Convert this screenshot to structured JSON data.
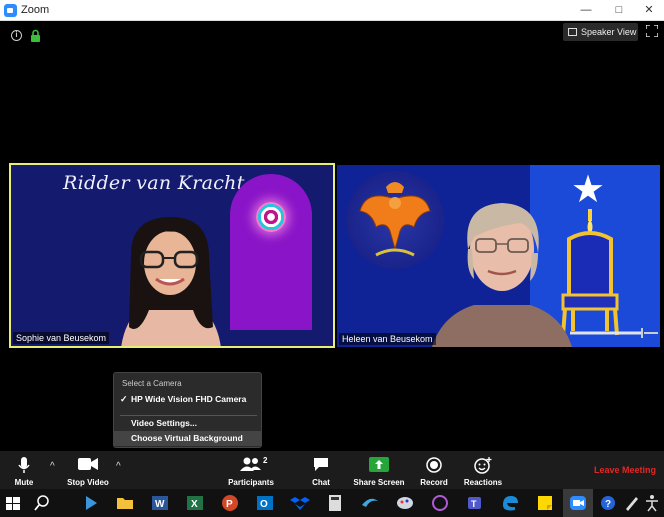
{
  "window": {
    "title": "Zoom",
    "minimize": "—",
    "maximize": "□",
    "close": "✕"
  },
  "topbar": {
    "info": "i",
    "view_label": "Speaker View"
  },
  "tiles": {
    "left": {
      "name": "Sophie van Beusekom",
      "background_text": "Ridder van Kracht"
    },
    "right": {
      "name": "Heleen van Beusekom"
    }
  },
  "camera_menu": {
    "header": "Select a Camera",
    "selected_camera": "HP Wide Vision FHD Camera",
    "check": "✓",
    "video_settings": "Video Settings...",
    "virtual_background": "Choose Virtual Background"
  },
  "toolbar": {
    "mute": "Mute",
    "stop_video": "Stop Video",
    "participants": "Participants",
    "participant_count": "2",
    "chat": "Chat",
    "share_screen": "Share Screen",
    "record": "Record",
    "reactions": "Reactions",
    "leave": "Leave Meeting",
    "caret": "^"
  },
  "colors": {
    "active_speaker_border": "#e8ee72",
    "share_green": "#25a53a",
    "leave_red": "#e02828",
    "zoom_blue": "#2d8cff"
  },
  "taskbar_icons": [
    "windows-start-icon",
    "search-icon",
    "visual-studio-icon",
    "file-explorer-icon",
    "word-icon",
    "excel-icon",
    "powerpoint-icon",
    "outlook-icon",
    "dropbox-icon",
    "calculator-icon",
    "sway-icon",
    "paint-icon",
    "photos-icon",
    "teams-icon",
    "edge-icon",
    "sticky-notes-icon",
    "zoom-icon",
    "help-icon",
    "pen-icon",
    "accessibility-icon"
  ]
}
